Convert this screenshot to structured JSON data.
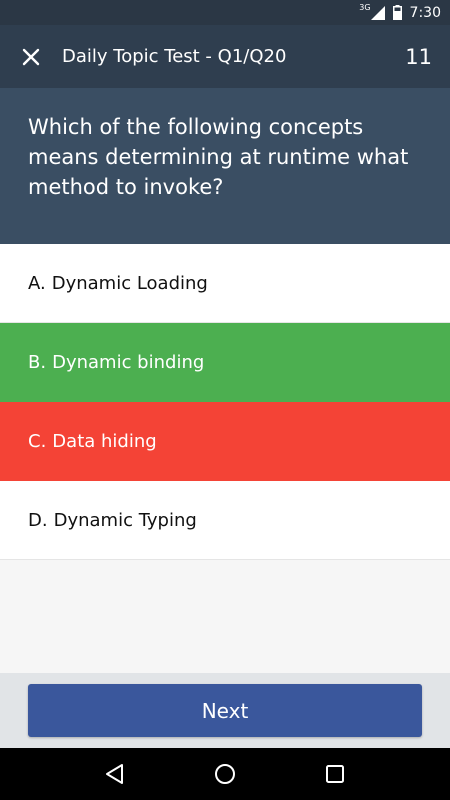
{
  "status_bar": {
    "network": "3G",
    "time": "7:30"
  },
  "header": {
    "title": "Daily Topic Test - Q1/Q20",
    "counter": "11"
  },
  "question": {
    "text": "Which of the following concepts means determining at runtime what method to invoke?"
  },
  "options": [
    {
      "letter": "A.",
      "text": "Dynamic Loading",
      "state": "default"
    },
    {
      "letter": "B.",
      "text": "Dynamic binding",
      "state": "correct"
    },
    {
      "letter": "C.",
      "text": "Data hiding",
      "state": "wrong"
    },
    {
      "letter": "D.",
      "text": "Dynamic Typing",
      "state": "default"
    }
  ],
  "footer": {
    "next_label": "Next"
  },
  "colors": {
    "app_bar": "#2f3e4f",
    "question_bg": "#3a4e63",
    "correct": "#4caf50",
    "wrong": "#f44336",
    "next_button": "#3a579c"
  },
  "nav": {
    "icons": [
      "back-icon",
      "home-icon",
      "recents-icon"
    ]
  }
}
